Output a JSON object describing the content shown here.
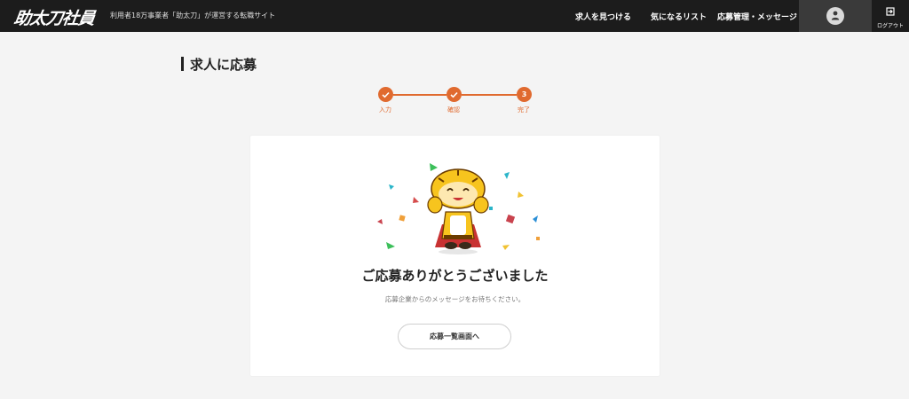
{
  "header": {
    "logo": "助太刀社員",
    "tagline": "利用者18万事業者「助太刀」が運営する転職サイト",
    "nav": {
      "find_jobs": "求人を見つける",
      "favorites": "気になるリスト",
      "applications": "応募管理・メッセージ"
    },
    "logout_label": "ログアウト"
  },
  "page": {
    "title": "求人に応募"
  },
  "stepper": {
    "steps": [
      {
        "label": "入力",
        "state": "done"
      },
      {
        "label": "確認",
        "state": "done"
      },
      {
        "label": "完了",
        "number": "3",
        "state": "current"
      }
    ]
  },
  "completion": {
    "title": "ご応募ありがとうございました",
    "subtitle": "応募企業からのメッセージをお待ちください。",
    "button_label": "応募一覧画面へ"
  },
  "colors": {
    "header_bg": "#1c1c1c",
    "accent": "#e06a2f",
    "page_bg": "#f4f4f4"
  },
  "icons": {
    "avatar": "user-icon",
    "logout": "logout-icon",
    "step_done": "check-icon",
    "mascot": "tiger-mascot-illustration"
  }
}
